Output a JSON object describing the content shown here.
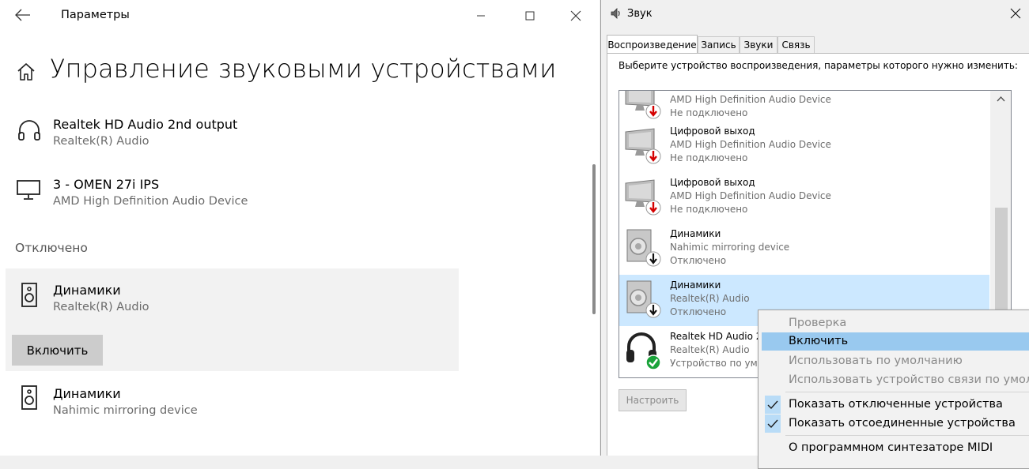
{
  "settings": {
    "window_title": "Параметры",
    "page_title": "Управление звуковыми устройствами",
    "devices_top": [
      {
        "name": "Realtek HD Audio 2nd output",
        "sub": "Realtek(R) Audio",
        "icon": "headphones-icon"
      },
      {
        "name": "3 - OMEN 27i IPS",
        "sub": "AMD High Definition Audio Device",
        "icon": "monitor-icon"
      }
    ],
    "disabled_label": "Отключено",
    "devices_disabled": [
      {
        "name": "Динамики",
        "sub": "Realtek(R) Audio",
        "icon": "speaker-icon"
      },
      {
        "name": "Динамики",
        "sub": "Nahimic mirroring device",
        "icon": "speaker-icon"
      }
    ],
    "enable_button": "Включить"
  },
  "sound_dialog": {
    "title": "Звук",
    "tabs": [
      "Воспроизведение",
      "Запись",
      "Звуки",
      "Связь"
    ],
    "active_tab": 0,
    "instruction": "Выберите устройство воспроизведения, параметры которого нужно изменить:",
    "devices": [
      {
        "name": "",
        "desc": "AMD High Definition Audio Device",
        "status": "Не подключено",
        "icon": "monitor-icon",
        "badge": "red-arrow"
      },
      {
        "name": "Цифровой выход",
        "desc": "AMD High Definition Audio Device",
        "status": "Не подключено",
        "icon": "monitor-icon",
        "badge": "red-arrow"
      },
      {
        "name": "Цифровой выход",
        "desc": "AMD High Definition Audio Device",
        "status": "Не подключено",
        "icon": "monitor-icon",
        "badge": "red-arrow"
      },
      {
        "name": "Динамики",
        "desc": "Nahimic mirroring device",
        "status": "Отключено",
        "icon": "speaker-icon",
        "badge": "down-arrow"
      },
      {
        "name": "Динамики",
        "desc": "Realtek(R) Audio",
        "status": "Отключено",
        "icon": "speaker-icon",
        "badge": "down-arrow",
        "selected": true
      },
      {
        "name": "Realtek HD Audio 2",
        "desc": "Realtek(R) Audio",
        "status": "Устройство по умо",
        "icon": "headphones-icon",
        "badge": "green-check"
      }
    ],
    "configure_button": "Настроить"
  },
  "context_menu": {
    "items": [
      {
        "label": "Проверка",
        "disabled": true
      },
      {
        "label": "Включить",
        "highlighted": true
      },
      {
        "label": "Использовать по умолчанию",
        "disabled": true
      },
      {
        "label": "Использовать устройство связи по умолчанию",
        "disabled": true
      },
      {
        "label": "Показать отключенные устройства",
        "checked": true
      },
      {
        "label": "Показать отсоединенные устройства",
        "checked": true
      },
      {
        "label": "О программном синтезаторе MIDI"
      }
    ]
  },
  "colors": {
    "selection": "#cce8ff",
    "menu_highlight": "#99c9ef",
    "status_red": "#d40000",
    "status_green": "#1aa33a"
  }
}
